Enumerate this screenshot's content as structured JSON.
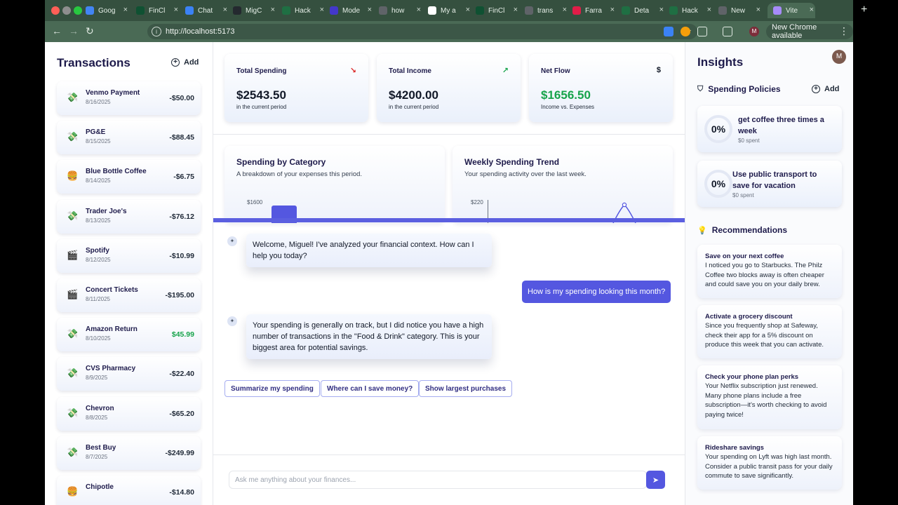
{
  "browser": {
    "tabs": [
      {
        "label": "Goog",
        "fav": "#4285f4"
      },
      {
        "label": "FinCl",
        "fav": "#0f5132"
      },
      {
        "label": "Chat",
        "fav": "#3b82f6"
      },
      {
        "label": "MigC",
        "fav": "#24292f"
      },
      {
        "label": "Hack",
        "fav": "#1f6f43"
      },
      {
        "label": "Mode",
        "fav": "#4338ca"
      },
      {
        "label": "how",
        "fav": "#5f6368"
      },
      {
        "label": "My a",
        "fav": "#ffffff"
      },
      {
        "label": "FinCl",
        "fav": "#0f5132"
      },
      {
        "label": "trans",
        "fav": "#5f6368"
      },
      {
        "label": "Farra",
        "fav": "#e11d48"
      },
      {
        "label": "Deta",
        "fav": "#1f6f43"
      },
      {
        "label": "Hack",
        "fav": "#1f6f43"
      },
      {
        "label": "New",
        "fav": "#5f6368"
      },
      {
        "label": "Vite",
        "fav": "#a78bfa"
      }
    ],
    "url": "http://localhost:5173",
    "chrome_available": "New Chrome available",
    "profile_initial": "M"
  },
  "transactions": {
    "title": "Transactions",
    "add_label": "Add",
    "items": [
      {
        "icon": "💸",
        "name": "Venmo Payment",
        "date": "8/16/2025",
        "amount": "-$50.00",
        "positive": false
      },
      {
        "icon": "💸",
        "name": "PG&E",
        "date": "8/15/2025",
        "amount": "-$88.45",
        "positive": false
      },
      {
        "icon": "🍔",
        "name": "Blue Bottle Coffee",
        "date": "8/14/2025",
        "amount": "-$6.75",
        "positive": false
      },
      {
        "icon": "💸",
        "name": "Trader Joe's",
        "date": "8/13/2025",
        "amount": "-$76.12",
        "positive": false
      },
      {
        "icon": "🎬",
        "name": "Spotify",
        "date": "8/12/2025",
        "amount": "-$10.99",
        "positive": false
      },
      {
        "icon": "🎬",
        "name": "Concert Tickets",
        "date": "8/11/2025",
        "amount": "-$195.00",
        "positive": false
      },
      {
        "icon": "💸",
        "name": "Amazon Return",
        "date": "8/10/2025",
        "amount": "$45.99",
        "positive": true
      },
      {
        "icon": "💸",
        "name": "CVS Pharmacy",
        "date": "8/9/2025",
        "amount": "-$22.40",
        "positive": false
      },
      {
        "icon": "💸",
        "name": "Chevron",
        "date": "8/8/2025",
        "amount": "-$65.20",
        "positive": false
      },
      {
        "icon": "💸",
        "name": "Best Buy",
        "date": "8/7/2025",
        "amount": "-$249.99",
        "positive": false
      },
      {
        "icon": "🍔",
        "name": "Chipotle",
        "date": "",
        "amount": "-$14.80",
        "positive": false
      }
    ]
  },
  "stats": [
    {
      "label": "Total Spending",
      "value": "$2543.50",
      "sub": "in the current period",
      "symbol": "↘",
      "symbol_color": "#dc2626",
      "value_color": "#111827"
    },
    {
      "label": "Total Income",
      "value": "$4200.00",
      "sub": "in the current period",
      "symbol": "↗",
      "symbol_color": "#16a34a",
      "value_color": "#111827"
    },
    {
      "label": "Net Flow",
      "value": "$1656.50",
      "sub": "Income vs. Expenses",
      "symbol": "$",
      "symbol_color": "#111827",
      "value_color": "#16a34a"
    }
  ],
  "charts": {
    "category": {
      "title": "Spending by Category",
      "subtitle": "A breakdown of your expenses this period.",
      "tick": "$1600"
    },
    "weekly": {
      "title": "Weekly Spending Trend",
      "subtitle": "Your spending activity over the last week.",
      "tick": "$220"
    }
  },
  "chat": {
    "welcome": "Welcome, Miguel! I've analyzed your financial context. How can I help you today?",
    "user_message": "How is my spending looking this month?",
    "reply": "Your spending is generally on track, but I did notice you have a high number of transactions in the \"Food & Drink\" category. This is your biggest area for potential savings.",
    "suggestions": [
      "Summarize my spending",
      "Where can I save money?",
      "Show largest purchases"
    ],
    "input_placeholder": "Ask me anything about your finances..."
  },
  "insights": {
    "title": "Insights",
    "policies_title": "Spending Policies",
    "add_label": "Add",
    "policies": [
      {
        "percent": "0%",
        "title": "get coffee three times a week",
        "spent": "$0 spent"
      },
      {
        "percent": "0%",
        "title": "Use public transport to save for vacation",
        "spent": "$0 spent"
      }
    ],
    "recommendations_title": "Recommendations",
    "recommendations": [
      {
        "title": "Save on your next coffee",
        "body": "I noticed you go to Starbucks. The Philz Coffee two blocks away is often cheaper and could save you on your daily brew."
      },
      {
        "title": "Activate a grocery discount",
        "body": "Since you frequently shop at Safeway, check their app for a 5% discount on produce this week that you can activate."
      },
      {
        "title": "Check your phone plan perks",
        "body": "Your Netflix subscription just renewed. Many phone plans include a free subscription—it's worth checking to avoid paying twice!"
      },
      {
        "title": "Rideshare savings",
        "body": "Your spending on Lyft was high last month. Consider a public transit pass for your daily commute to save significantly."
      }
    ]
  }
}
